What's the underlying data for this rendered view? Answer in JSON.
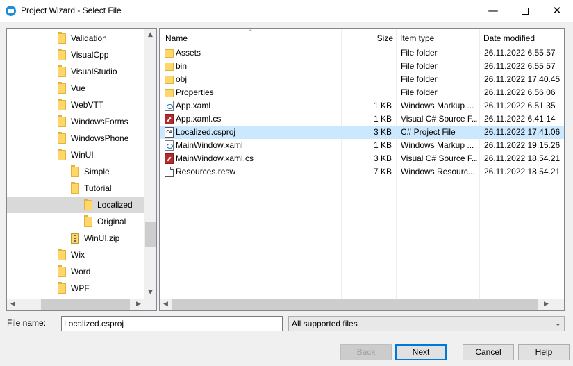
{
  "window": {
    "title": "Project Wizard - Select File",
    "minimize_glyph": "—",
    "close_glyph": "✕"
  },
  "tree": {
    "items": [
      {
        "label": "Validation",
        "depth": 0,
        "icon": "folder-icon"
      },
      {
        "label": "VisualCpp",
        "depth": 0,
        "icon": "folder-icon"
      },
      {
        "label": "VisualStudio",
        "depth": 0,
        "icon": "folder-icon"
      },
      {
        "label": "Vue",
        "depth": 0,
        "icon": "folder-icon"
      },
      {
        "label": "WebVTT",
        "depth": 0,
        "icon": "folder-icon"
      },
      {
        "label": "WindowsForms",
        "depth": 0,
        "icon": "folder-icon"
      },
      {
        "label": "WindowsPhone",
        "depth": 0,
        "icon": "folder-icon"
      },
      {
        "label": "WinUI",
        "depth": 0,
        "icon": "folder-icon"
      },
      {
        "label": "Simple",
        "depth": 1,
        "icon": "folder-icon"
      },
      {
        "label": "Tutorial",
        "depth": 1,
        "icon": "folder-icon"
      },
      {
        "label": "Localized",
        "depth": 2,
        "icon": "folder-icon",
        "selected": true
      },
      {
        "label": "Original",
        "depth": 2,
        "icon": "folder-icon"
      },
      {
        "label": "WinUI.zip",
        "depth": 1,
        "icon": "zip-icon"
      },
      {
        "label": "Wix",
        "depth": 0,
        "icon": "folder-icon"
      },
      {
        "label": "Word",
        "depth": 0,
        "icon": "folder-icon"
      },
      {
        "label": "WPF",
        "depth": 0,
        "icon": "folder-icon"
      }
    ],
    "scroll_up_glyph": "▲",
    "scroll_down_glyph": "▼",
    "scroll_left_glyph": "◀",
    "scroll_right_glyph": "▶"
  },
  "list": {
    "columns": {
      "name": "Name",
      "size": "Size",
      "type": "Item type",
      "date": "Date modified"
    },
    "sort_glyph": "⌃",
    "rows": [
      {
        "name": "Assets",
        "size": "",
        "type": "File folder",
        "date": "26.11.2022 6.55.57",
        "icon": "folder-icon"
      },
      {
        "name": "bin",
        "size": "",
        "type": "File folder",
        "date": "26.11.2022 6.55.57",
        "icon": "folder-icon"
      },
      {
        "name": "obj",
        "size": "",
        "type": "File folder",
        "date": "26.11.2022 17.40.45",
        "icon": "folder-icon"
      },
      {
        "name": "Properties",
        "size": "",
        "type": "File folder",
        "date": "26.11.2022 6.56.06",
        "icon": "folder-icon"
      },
      {
        "name": "App.xaml",
        "size": "1 KB",
        "type": "Windows Markup ...",
        "date": "26.11.2022 6.51.35",
        "icon": "xaml-file-icon"
      },
      {
        "name": "App.xaml.cs",
        "size": "1 KB",
        "type": "Visual C# Source F...",
        "date": "26.11.2022 6.41.14",
        "icon": "csharp-file-icon"
      },
      {
        "name": "Localized.csproj",
        "size": "3 KB",
        "type": "C# Project File",
        "date": "26.11.2022 17.41.06",
        "icon": "csproj-file-icon",
        "selected": true
      },
      {
        "name": "MainWindow.xaml",
        "size": "1 KB",
        "type": "Windows Markup ...",
        "date": "26.11.2022 19.15.26",
        "icon": "xaml-file-icon"
      },
      {
        "name": "MainWindow.xaml.cs",
        "size": "3 KB",
        "type": "Visual C# Source F...",
        "date": "26.11.2022 18.54.21",
        "icon": "csharp-file-icon"
      },
      {
        "name": "Resources.resw",
        "size": "7 KB",
        "type": "Windows Resourc...",
        "date": "26.11.2022 18.54.21",
        "icon": "resw-file-icon"
      }
    ],
    "csproj_glyph": "C#"
  },
  "footer": {
    "filename_label": "File name:",
    "filename_value": "Localized.csproj",
    "filter_value": "All supported files",
    "filter_chevron": "⌄"
  },
  "buttons": {
    "back": "Back",
    "next": "Next",
    "cancel": "Cancel",
    "help": "Help"
  }
}
